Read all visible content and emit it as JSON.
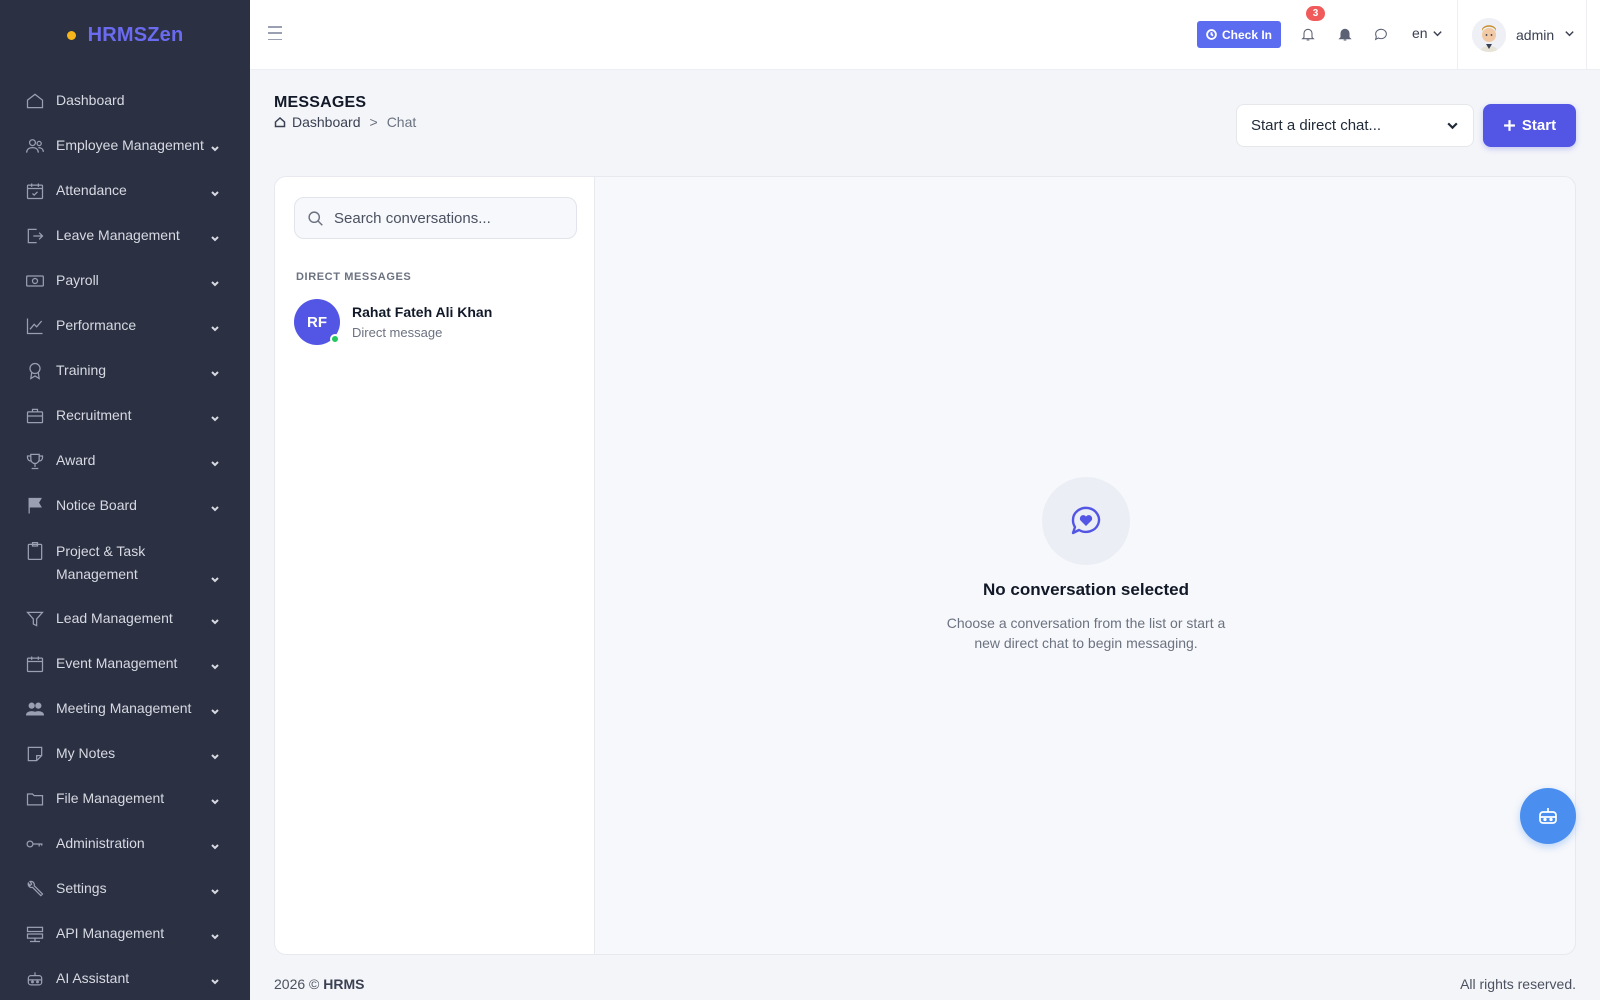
{
  "app": {
    "brand": "HRMSZen",
    "brand_color": "#6b6bf0",
    "accent": "#5356e4"
  },
  "sidebar": {
    "items": [
      {
        "label": "Dashboard",
        "icon": "home-icon",
        "has_chevron": false
      },
      {
        "label": "Employee Management",
        "icon": "users-icon",
        "has_chevron": true
      },
      {
        "label": "Attendance",
        "icon": "calendar-check-icon",
        "has_chevron": true
      },
      {
        "label": "Leave Management",
        "icon": "logout-icon",
        "has_chevron": true
      },
      {
        "label": "Payroll",
        "icon": "money-icon",
        "has_chevron": true
      },
      {
        "label": "Performance",
        "icon": "chart-line-icon",
        "has_chevron": true
      },
      {
        "label": "Training",
        "icon": "award-icon",
        "has_chevron": true
      },
      {
        "label": "Recruitment",
        "icon": "briefcase-icon",
        "has_chevron": true
      },
      {
        "label": "Award",
        "icon": "trophy-icon",
        "has_chevron": true
      },
      {
        "label": "Notice Board",
        "icon": "flag-icon",
        "has_chevron": true
      },
      {
        "label": "Project & Task Management",
        "icon": "clipboard-icon",
        "has_chevron": true
      },
      {
        "label": "Lead Management",
        "icon": "funnel-icon",
        "has_chevron": true
      },
      {
        "label": "Event Management",
        "icon": "calendar-icon",
        "has_chevron": true
      },
      {
        "label": "Meeting Management",
        "icon": "group-icon",
        "has_chevron": true
      },
      {
        "label": "My Notes",
        "icon": "note-icon",
        "has_chevron": true
      },
      {
        "label": "File Management",
        "icon": "folder-icon",
        "has_chevron": true
      },
      {
        "label": "Administration",
        "icon": "key-icon",
        "has_chevron": true
      },
      {
        "label": "Settings",
        "icon": "wrench-icon",
        "has_chevron": true
      },
      {
        "label": "API Management",
        "icon": "server-icon",
        "has_chevron": true
      },
      {
        "label": "AI Assistant",
        "icon": "robot-icon",
        "has_chevron": true
      }
    ]
  },
  "topbar": {
    "check_in_label": "Check In",
    "notification_count": "3",
    "language": "en",
    "user_name": "admin"
  },
  "page": {
    "title": "MESSAGES",
    "breadcrumb_home": "Dashboard",
    "breadcrumb_sep": ">",
    "breadcrumb_current": "Chat",
    "direct_chat_select": "Start a direct chat...",
    "start_button": "Start"
  },
  "chat": {
    "search_placeholder": "Search conversations...",
    "section_label": "DIRECT MESSAGES",
    "conversations": [
      {
        "initials": "RF",
        "name": "Rahat Fateh Ali Khan",
        "subtitle": "Direct message",
        "online": true
      }
    ],
    "empty_title": "No conversation selected",
    "empty_desc": "Choose a conversation from the list or start a new direct chat to begin messaging."
  },
  "footer": {
    "year_prefix": "2026 ©",
    "brand": "HRMS",
    "rights": "All rights reserved."
  }
}
